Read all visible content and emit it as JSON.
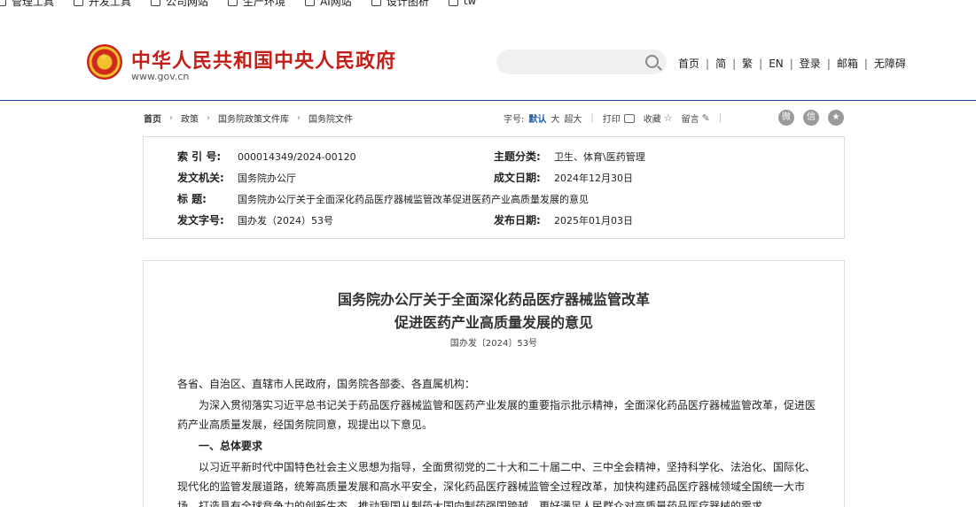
{
  "bookmarks": [
    "管理工具",
    "开发工具",
    "公司网站",
    "生产环境",
    "AI网站",
    "设计图析",
    "tw"
  ],
  "header": {
    "site_title": "中华人民共和国中央人民政府",
    "site_domain": "www.gov.cn",
    "search_placeholder": "",
    "nav": [
      "首页",
      "简",
      "繁",
      "EN",
      "登录",
      "邮箱",
      "无障碍"
    ]
  },
  "breadcrumb": [
    "首页",
    "政策",
    "国务院政策文件库",
    "国务院文件"
  ],
  "tools": {
    "font_label": "字号:",
    "font_sizes": [
      "默认",
      "大",
      "超大"
    ],
    "print": "打印",
    "favorite": "收藏",
    "comment": "留言"
  },
  "share_icons": [
    "weibo-icon",
    "wechat-icon",
    "qzone-icon"
  ],
  "info": {
    "index_label": "索 引 号:",
    "index_value": "000014349/2024-00120",
    "topic_label": "主题分类:",
    "topic_value": "卫生、体育\\医药管理",
    "issuer_label": "发文机关:",
    "issuer_value": "国务院办公厅",
    "date_label": "成文日期:",
    "date_value": "2024年12月30日",
    "title_label": "标 题:",
    "title_value": "国务院办公厅关于全面深化药品医疗器械监管改革促进医药产业高质量发展的意见",
    "docno_label": "发文字号:",
    "docno_value": "国办发（2024）53号",
    "pub_label": "发布日期:",
    "pub_value": "2025年01月03日"
  },
  "article": {
    "title_line1": "国务院办公厅关于全面深化药品医疗器械监管改革",
    "title_line2": "促进医药产业高质量发展的意见",
    "docno": "国办发〔2024〕53号",
    "salutation": "各省、自治区、直辖市人民政府，国务院各部委、各直属机构：",
    "para1": "为深入贯彻落实习近平总书记关于药品医疗器械监管和医药产业发展的重要指示批示精神，全面深化药品医疗器械监管改革，促进医药产业高质量发展，经国务院同意，现提出以下意见。",
    "section1": "一、总体要求",
    "para2": "以习近平新时代中国特色社会主义思想为指导，全面贯彻党的二十大和二十届二中、三中全会精神，坚持科学化、法治化、国际化、现代化的监管发展道路，统筹高质量发展和高水平安全，深化药品医疗器械监管全过程改革，加快构建药品医疗器械领域全国统一大市场，打造具有全球竞争力的创新生态，推动我国从制药大国向制药强国跨越，更好满足人民群众对高质量药品医疗器械的需求。"
  }
}
